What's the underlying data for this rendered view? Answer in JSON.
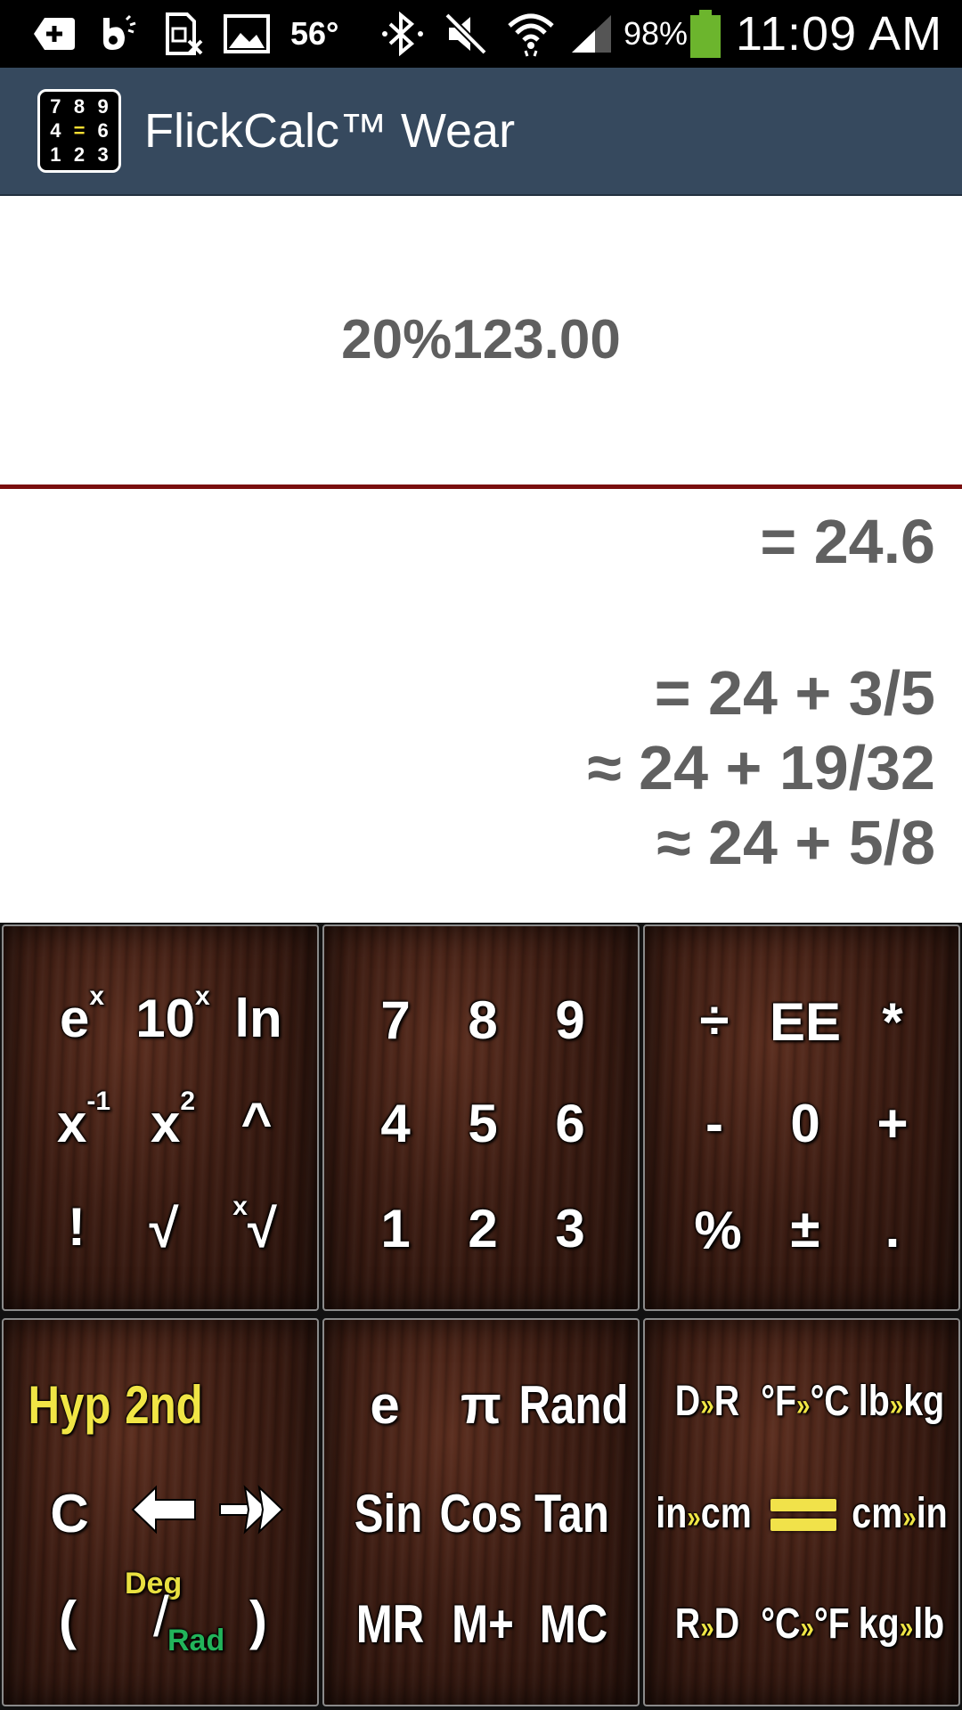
{
  "status_bar": {
    "temperature": "56°",
    "battery": "98%",
    "time": "11:09 AM",
    "icons": [
      "add-icon",
      "b-app-icon",
      "sim-error-icon",
      "image-icon",
      "bluetooth-icon",
      "mute-icon",
      "wifi-icon",
      "signal-icon",
      "battery-icon"
    ]
  },
  "action_bar": {
    "icon_digits": [
      "7",
      "8",
      "9",
      "4",
      "=",
      "6",
      "1",
      "2",
      "3"
    ],
    "title": "FlickCalc™ Wear"
  },
  "display": {
    "expression": "20%123.00",
    "result": "= 24.6",
    "fractions": [
      "= 24 + 3/5",
      "≈ 24 + 19/32",
      "≈ 24 + 5/8"
    ]
  },
  "keypad": {
    "functions": {
      "ex_base": "e",
      "ex_exp": "x",
      "tenx_base": "10",
      "tenx_exp": "x",
      "ln": "ln",
      "inv_base": "x",
      "inv_exp": "-1",
      "sq_base": "x",
      "sq_exp": "2",
      "pow": "^",
      "fact": "!",
      "sqrt": "√",
      "xroot_idx": "x",
      "xroot": "√"
    },
    "digits": [
      "7",
      "8",
      "9",
      "4",
      "5",
      "6",
      "1",
      "2",
      "3"
    ],
    "operators": [
      "÷",
      "EE",
      "*",
      "-",
      "0",
      "+",
      "%",
      "±",
      "."
    ],
    "controls": {
      "hyp": "Hyp",
      "second": "2nd",
      "clear": "C",
      "back": "🡐",
      "forward": "⇾",
      "open_paren": "(",
      "deg": "Deg",
      "slash": "/",
      "rad": "Rad",
      "close_paren": ")"
    },
    "constants": [
      "e",
      "π",
      "Rand",
      "Sin",
      "Cos",
      "Tan",
      "MR",
      "M+",
      "MC"
    ],
    "conversions": {
      "d_r": [
        "D",
        "R"
      ],
      "f_c": [
        "°F",
        "°C"
      ],
      "lb_kg": [
        "lb",
        "kg"
      ],
      "in_cm": [
        "in",
        "cm"
      ],
      "cm_in": [
        "cm",
        "in"
      ],
      "r_d": [
        "R",
        "D"
      ],
      "c_f": [
        "°C",
        "°F"
      ],
      "kg_lb": [
        "kg",
        "lb"
      ],
      "arrow": "»"
    }
  }
}
